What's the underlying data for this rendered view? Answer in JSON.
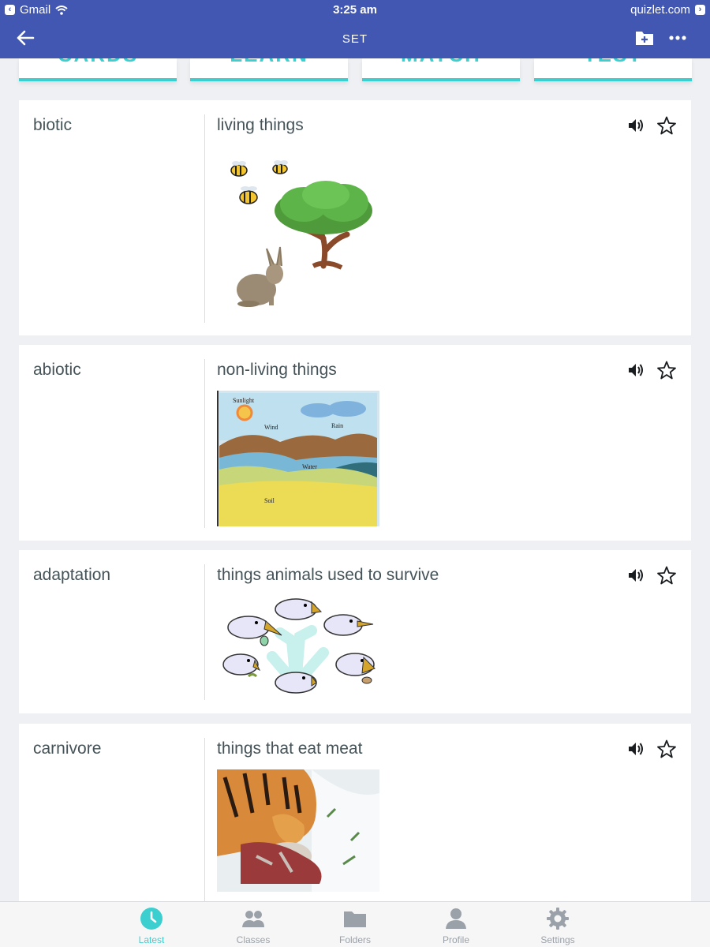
{
  "status_bar": {
    "back_app": "Gmail",
    "time": "3:25 am",
    "url": "quizlet.com"
  },
  "app_bar": {
    "title": "SET"
  },
  "study_modes": [
    "CARDS",
    "LEARN",
    "MATCH",
    "TEST"
  ],
  "terms": [
    {
      "term": "biotic",
      "definition": "living things",
      "image": "bees-tree-rabbit"
    },
    {
      "term": "abiotic",
      "definition": "non-living things",
      "image": "landscape",
      "image_labels": {
        "sunlight": "Sunlight",
        "wind": "Wind",
        "rain": "Rain",
        "water": "Water",
        "soil": "Soil"
      }
    },
    {
      "term": "adaptation",
      "definition": "things animals used to survive",
      "image": "bird-beaks"
    },
    {
      "term": "carnivore",
      "definition": "things that eat meat",
      "image": "tiger-eating"
    }
  ],
  "tab_bar": [
    {
      "label": "Latest",
      "icon": "clock-icon",
      "active": true
    },
    {
      "label": "Classes",
      "icon": "people-icon",
      "active": false
    },
    {
      "label": "Folders",
      "icon": "folder-icon",
      "active": false
    },
    {
      "label": "Profile",
      "icon": "person-icon",
      "active": false
    },
    {
      "label": "Settings",
      "icon": "gear-icon",
      "active": false
    }
  ],
  "colors": {
    "header": "#4257b2",
    "accent": "#3ccfcf",
    "background": "#eef0f3",
    "text": "#455358"
  }
}
